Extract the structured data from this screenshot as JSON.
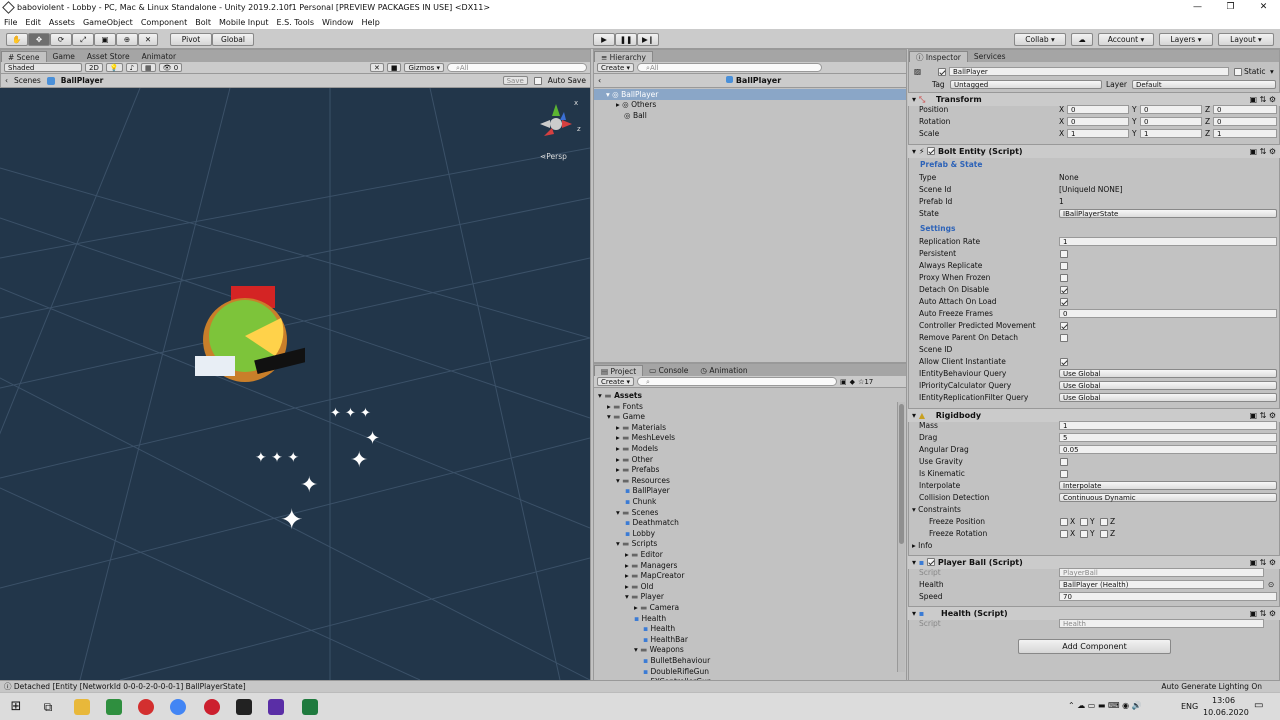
{
  "window": {
    "title": "baboviolent - Lobby - PC, Mac & Linux Standalone - Unity 2019.2.10f1 Personal [PREVIEW PACKAGES IN USE] <DX11>"
  },
  "menu": [
    "File",
    "Edit",
    "Assets",
    "GameObject",
    "Component",
    "Bolt",
    "Mobile Input",
    "E.S. Tools",
    "Window",
    "Help"
  ],
  "toolbar": {
    "pivot": "Pivot",
    "global": "Global",
    "collab": "Collab ▾",
    "account": "Account",
    "layers": "Layers",
    "layout": "Layout"
  },
  "scene_panel": {
    "tabs": [
      "Scene",
      "Game",
      "Asset Store",
      "Animator"
    ],
    "shading": "Shaded",
    "mode2d": "2D",
    "fx_count": "0",
    "gizmos": "Gizmos",
    "search_placeholder": "All",
    "breadcrumb_root": "Scenes",
    "breadcrumb_obj": "BallPlayer",
    "save": "Save",
    "autosave": "Auto Save",
    "persp": "Persp",
    "axis_x": "x",
    "axis_z": "z"
  },
  "hierarchy": {
    "tab": "Hierarchy",
    "create": "Create",
    "search_placeholder": "All",
    "title": "BallPlayer",
    "items": [
      "BallPlayer",
      "Others",
      "Ball"
    ]
  },
  "project": {
    "tabs": [
      "Project",
      "Console",
      "Animation"
    ],
    "create": "Create",
    "badge": "17",
    "tree": [
      {
        "label": "Assets",
        "level": 0
      },
      {
        "label": "Fonts",
        "level": 1
      },
      {
        "label": "Game",
        "level": 1
      },
      {
        "label": "Materials",
        "level": 2
      },
      {
        "label": "MeshLevels",
        "level": 2
      },
      {
        "label": "Models",
        "level": 2
      },
      {
        "label": "Other",
        "level": 2
      },
      {
        "label": "Prefabs",
        "level": 2
      },
      {
        "label": "Resources",
        "level": 2
      },
      {
        "label": "BallPlayer",
        "level": 3
      },
      {
        "label": "Chunk",
        "level": 3
      },
      {
        "label": "Scenes",
        "level": 2
      },
      {
        "label": "Deathmatch",
        "level": 3
      },
      {
        "label": "Lobby",
        "level": 3
      },
      {
        "label": "Scripts",
        "level": 2
      },
      {
        "label": "Editor",
        "level": 3
      },
      {
        "label": "Managers",
        "level": 3
      },
      {
        "label": "MapCreator",
        "level": 3
      },
      {
        "label": "Old",
        "level": 3
      },
      {
        "label": "Player",
        "level": 3
      },
      {
        "label": "Camera",
        "level": 4
      },
      {
        "label": "Health",
        "level": 4
      },
      {
        "label": "Health",
        "level": 5
      },
      {
        "label": "HealthBar",
        "level": 5
      },
      {
        "label": "Weapons",
        "level": 4
      },
      {
        "label": "BulletBehaviour",
        "level": 5
      },
      {
        "label": "DoubleRifleGun",
        "level": 5
      },
      {
        "label": "FXControllerGun",
        "level": 5
      }
    ]
  },
  "inspector": {
    "tabs": [
      "Inspector",
      "Services"
    ],
    "object_name": "BallPlayer",
    "static": "Static",
    "tag_label": "Tag",
    "tag": "Untagged",
    "layer_label": "Layer",
    "layer": "Default",
    "transform": {
      "title": "Transform",
      "rows": [
        {
          "label": "Position",
          "x": "0",
          "y": "0",
          "z": "0"
        },
        {
          "label": "Rotation",
          "x": "0",
          "y": "0",
          "z": "0"
        },
        {
          "label": "Scale",
          "x": "1",
          "y": "1",
          "z": "1"
        }
      ]
    },
    "bolt": {
      "title": "Bolt Entity (Script)",
      "section1": "Prefab & State",
      "type_label": "Type",
      "type": "None",
      "sceneid_label": "Scene Id",
      "sceneid": "[UniqueId NONE]",
      "prefabid_label": "Prefab Id",
      "prefabid": "1",
      "state_label": "State",
      "state": "IBallPlayerState",
      "section2": "Settings",
      "rep_label": "Replication Rate",
      "rep": "1",
      "persistent": "Persistent",
      "always": "Always Replicate",
      "proxy": "Proxy When Frozen",
      "detach": "Detach On Disable",
      "autoattach": "Auto Attach On Load",
      "freeze_label": "Auto Freeze Frames",
      "freeze": "0",
      "cpm": "Controller Predicted Movement",
      "rpod": "Remove Parent On Detach",
      "sceneid2": "Scene ID",
      "aci": "Allow Client Instantiate",
      "q1_label": "IEntityBehaviour Query",
      "q1": "Use Global",
      "q2_label": "IPriorityCalculator Query",
      "q2": "Use Global",
      "q3_label": "IEntityReplicationFilter Query",
      "q3": "Use Global"
    },
    "rigidbody": {
      "title": "Rigidbody",
      "mass_label": "Mass",
      "mass": "1",
      "drag_label": "Drag",
      "drag": "5",
      "adrag_label": "Angular Drag",
      "adrag": "0.05",
      "gravity": "Use Gravity",
      "kinematic": "Is Kinematic",
      "interp_label": "Interpolate",
      "interp": "Interpolate",
      "coll_label": "Collision Detection",
      "coll": "Continuous Dynamic",
      "constraints": "Constraints",
      "fpos": "Freeze Position",
      "frot": "Freeze Rotation",
      "info": "Info"
    },
    "playerball": {
      "title": "Player Ball (Script)",
      "script_label": "Script",
      "script": "PlayerBall",
      "health_label": "Health",
      "health": "BallPlayer (Health)",
      "speed_label": "Speed",
      "speed": "70"
    },
    "health": {
      "title": "Health (Script)",
      "script_label": "Script",
      "script": "Health"
    },
    "add_component": "Add Component"
  },
  "status": {
    "left": "Detached [Entity [NetworkId 0-0-0-2-0-0-0-1] BallPlayerState]",
    "right": "Auto Generate Lighting On"
  },
  "taskbar": {
    "lang": "ENG",
    "time": "13:06",
    "date": "10.06.2020"
  }
}
